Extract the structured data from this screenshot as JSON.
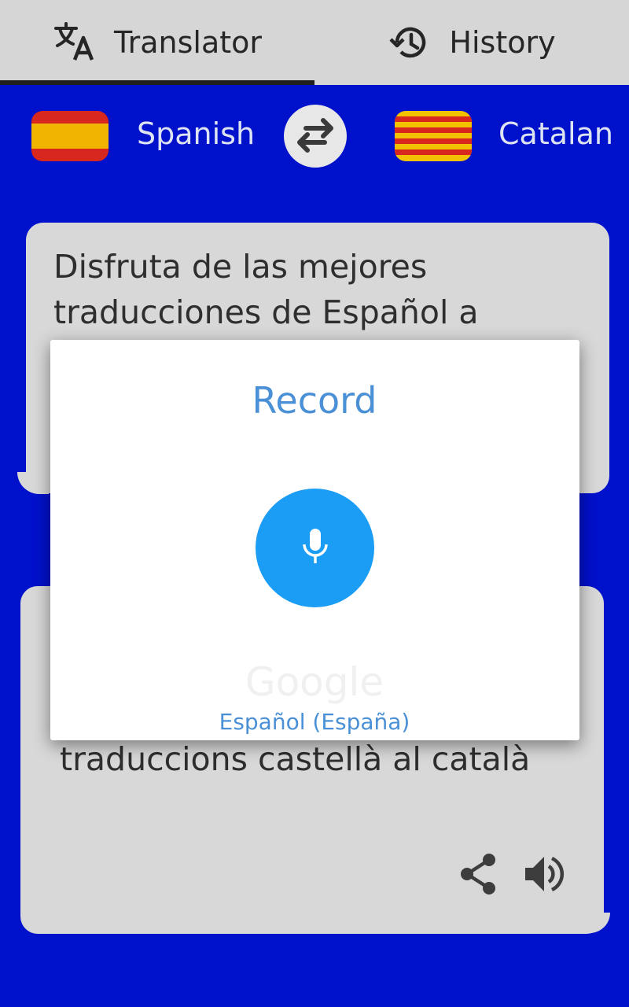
{
  "tabs": {
    "translator": {
      "label": "Translator",
      "icon": "translate-icon",
      "selected": true
    },
    "history": {
      "label": "History",
      "icon": "history-icon",
      "selected": false
    }
  },
  "languages": {
    "source": {
      "label": "Spanish",
      "flag": "spain-flag"
    },
    "target": {
      "label": "Catalan",
      "flag": "catalonia-flag"
    },
    "swap_icon": "swap-icon"
  },
  "source_card": {
    "text": "Disfruta de las mejores traducciones de Español a"
  },
  "target_card": {
    "text": "traduccions castellà al català",
    "actions": [
      "share-icon",
      "speaker-icon"
    ]
  },
  "dialog": {
    "title": "Record",
    "mic_icon": "microphone-icon",
    "watermark": "Google",
    "language": "Español (España)"
  },
  "colors": {
    "background": "#0011cc",
    "tabbar": "#d6d6d6",
    "card": "#d8d8d8",
    "accent_blue": "#1b9cf5",
    "dialog_text": "#4a90d6"
  }
}
